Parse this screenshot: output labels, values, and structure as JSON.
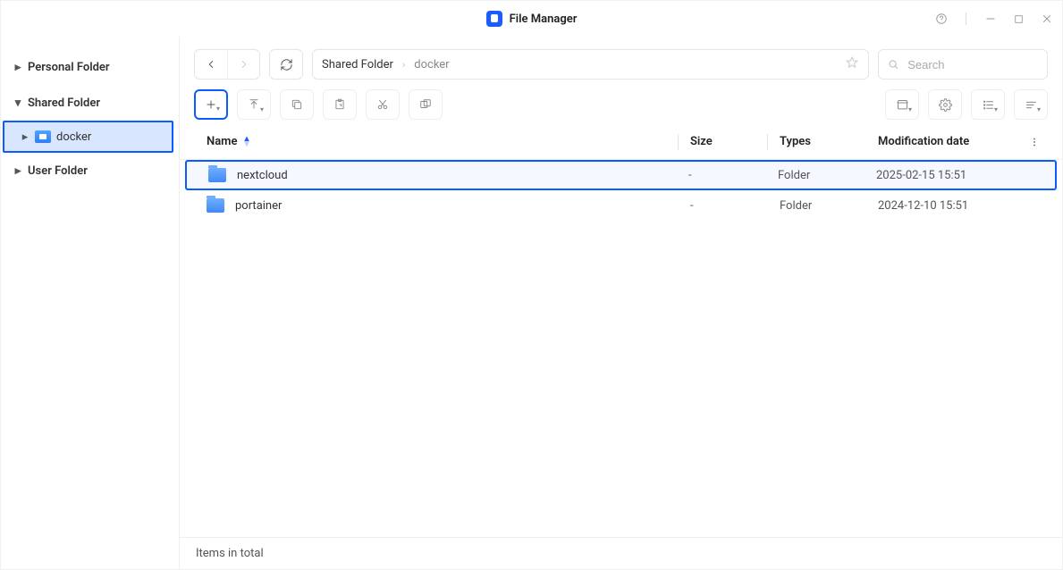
{
  "app": {
    "title": "File Manager"
  },
  "sidebar": {
    "items": [
      {
        "label": "Personal Folder",
        "expanded": false
      },
      {
        "label": "Shared Folder",
        "expanded": true,
        "children": [
          {
            "label": "docker",
            "selected": true
          }
        ]
      },
      {
        "label": "User Folder",
        "expanded": false
      }
    ]
  },
  "breadcrumb": {
    "segments": [
      {
        "label": "Shared Folder"
      },
      {
        "label": "docker"
      }
    ]
  },
  "search": {
    "placeholder": "Search"
  },
  "columns": {
    "name": "Name",
    "size": "Size",
    "type": "Types",
    "date": "Modification date"
  },
  "rows": [
    {
      "name": "nextcloud",
      "size": "-",
      "type": "Folder",
      "date": "2025-02-15 15:51",
      "selected": true
    },
    {
      "name": "portainer",
      "size": "-",
      "type": "Folder",
      "date": "2024-12-10 15:51",
      "selected": false
    }
  ],
  "status": {
    "text": "Items in total"
  }
}
